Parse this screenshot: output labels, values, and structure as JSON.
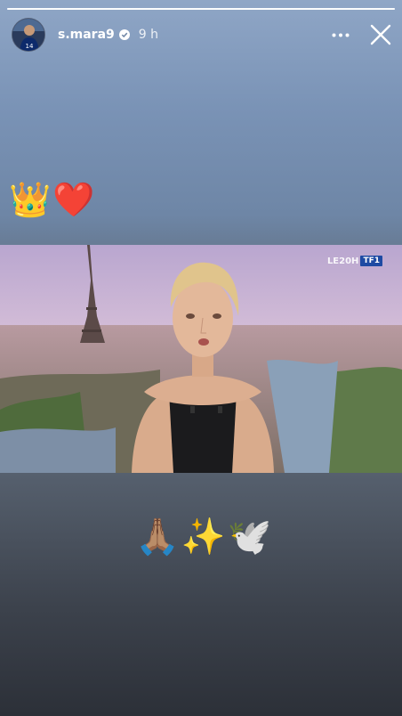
{
  "story": {
    "progress": 1.0,
    "username": "s.mara9",
    "time": "9 h",
    "caption_top": "👑❤️",
    "caption_bottom": "🙏🏽✨🕊️",
    "icons": {
      "verified": "verified-badge-icon",
      "more": "more-options-icon",
      "close": "close-icon"
    }
  },
  "video": {
    "logo_prefix": "LE20H",
    "logo_channel": "TF1",
    "colors": {
      "tf1": "#1d4aa3"
    }
  }
}
